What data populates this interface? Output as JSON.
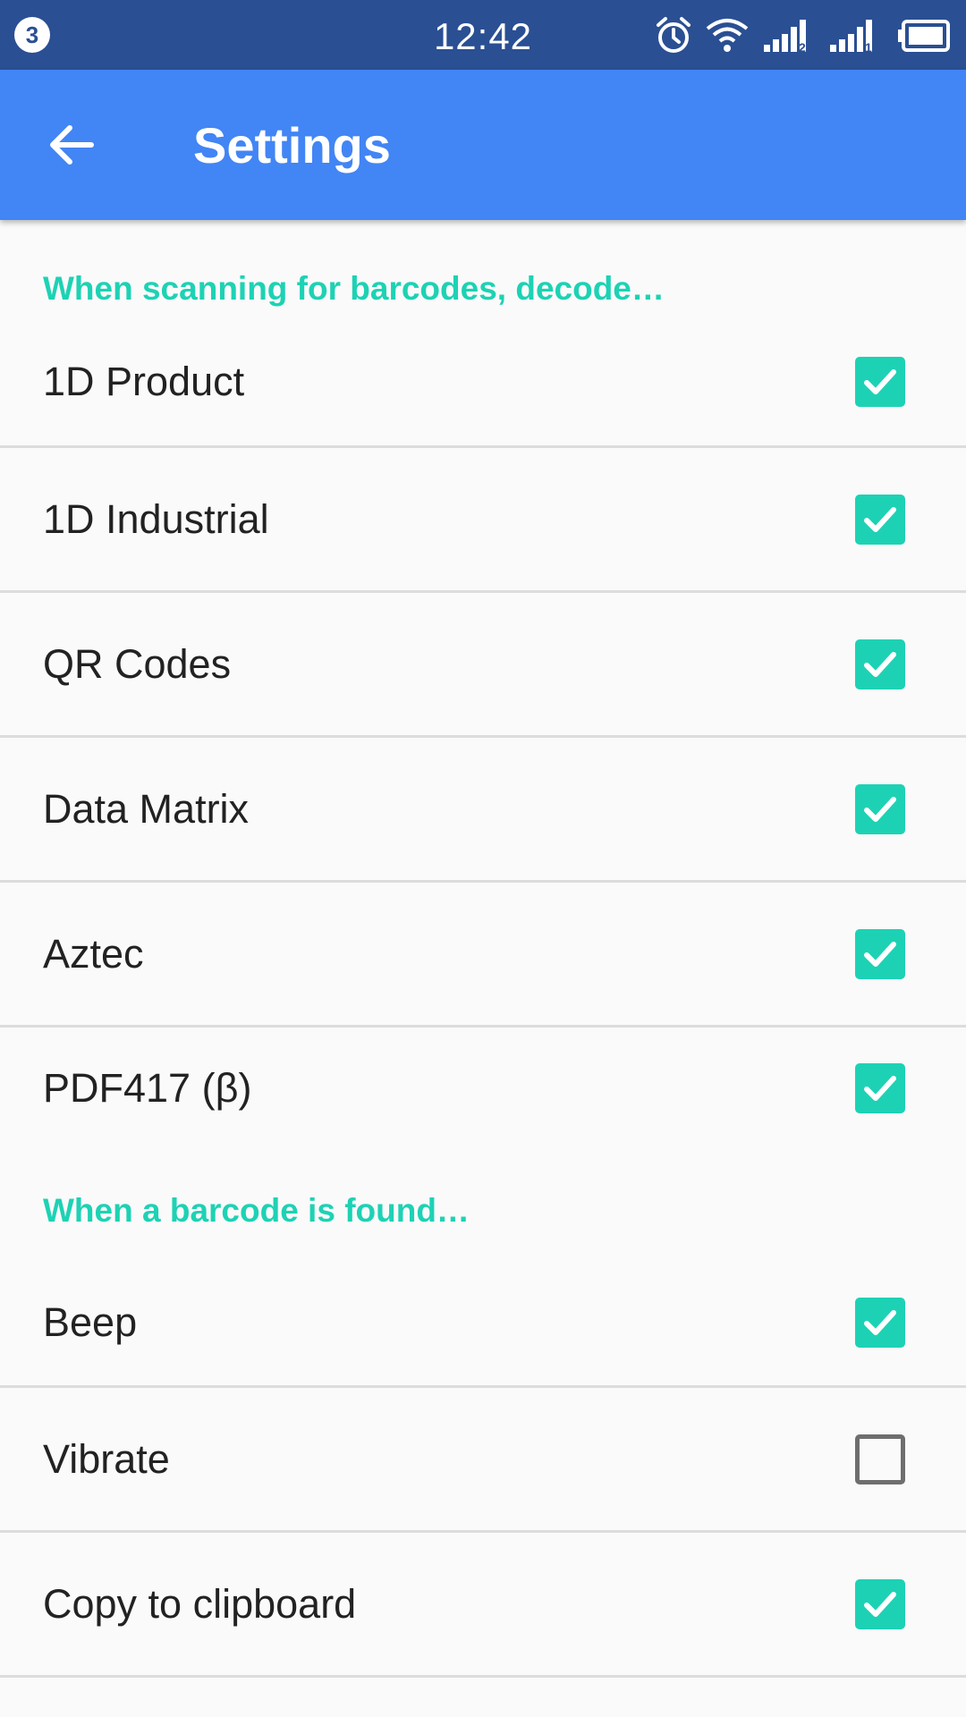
{
  "status_bar": {
    "notification_count": "3",
    "time": "12:42",
    "icons": [
      "alarm-icon",
      "wifi-icon",
      "signal-sim1-icon",
      "signal-sim2-icon",
      "battery-icon"
    ]
  },
  "app_bar": {
    "title": "Settings",
    "back_icon": "arrow-back-icon",
    "color": "#4285f4"
  },
  "colors": {
    "status_bar": "#2a4f93",
    "accent": "#1dd2b4",
    "unchecked_border": "#6e6e6e"
  },
  "sections": [
    {
      "header": "When scanning for barcodes, decode…",
      "items": [
        {
          "label": "1D Product",
          "checked": true
        },
        {
          "label": "1D Industrial",
          "checked": true
        },
        {
          "label": "QR Codes",
          "checked": true
        },
        {
          "label": "Data Matrix",
          "checked": true
        },
        {
          "label": "Aztec",
          "checked": true
        },
        {
          "label": "PDF417 (β)",
          "checked": true
        }
      ]
    },
    {
      "header": "When a barcode is found…",
      "items": [
        {
          "label": "Beep",
          "checked": true
        },
        {
          "label": "Vibrate",
          "checked": false
        },
        {
          "label": "Copy to clipboard",
          "checked": true
        }
      ]
    }
  ]
}
